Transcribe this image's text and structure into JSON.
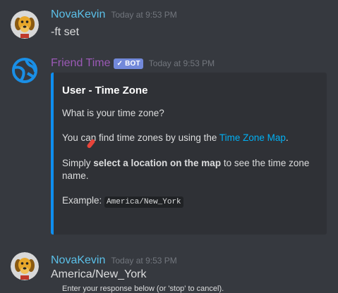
{
  "messages": [
    {
      "username": "NovaKevin",
      "username_color": "#5bc0e8",
      "timestamp": "Today at 9:53 PM",
      "text": "-ft set",
      "avatar_icon": "dog-avatar-icon"
    },
    {
      "username": "Friend Time",
      "username_color": "#9b59b6",
      "bot_tag": "BOT",
      "timestamp": "Today at 9:53 PM",
      "avatar_icon": "globe-avatar-icon",
      "embed": {
        "accent_color": "#0e8ef0",
        "title": "User - Time Zone",
        "question": "What is your time zone?",
        "find_prefix": "You can find time zones by using the ",
        "find_link": "Time Zone Map",
        "find_suffix": ".",
        "simply_prefix": "Simply ",
        "simply_bold": "select a location on the map",
        "simply_suffix": " to see the time zone",
        "simply_line2": "name.",
        "example_label": "Example: ",
        "example_code": "America/New_York",
        "footer": "Enter your response below (or 'stop' to cancel)."
      }
    },
    {
      "username": "NovaKevin",
      "username_color": "#5bc0e8",
      "timestamp": "Today at 9:53 PM",
      "text": "America/New_York",
      "avatar_icon": "dog-avatar-icon"
    }
  ]
}
